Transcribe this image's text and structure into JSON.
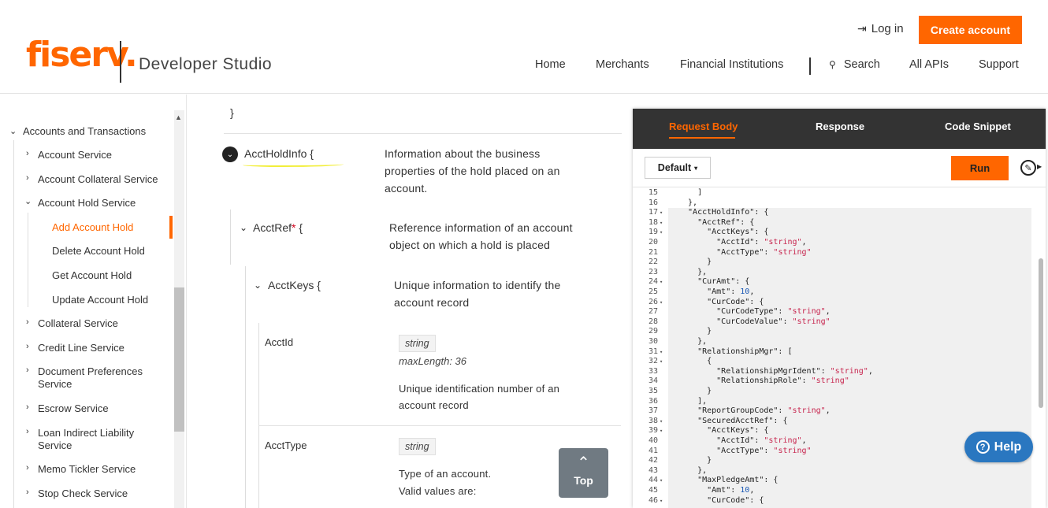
{
  "header": {
    "logo_text": "fiserv.",
    "product_name": "Developer Studio",
    "login_label": "Log in",
    "create_account_label": "Create account",
    "nav": [
      "Home",
      "Merchants",
      "Financial Institutions",
      "Search",
      "All APIs",
      "Support"
    ]
  },
  "sidebar": {
    "items": [
      {
        "label": "Accounts and Transactions",
        "expanded": true
      },
      {
        "label": "Account Service",
        "expanded": false
      },
      {
        "label": "Account Collateral Service",
        "expanded": false
      },
      {
        "label": "Account Hold Service",
        "expanded": true
      },
      {
        "label": "Add Account Hold",
        "active": true
      },
      {
        "label": "Delete Account Hold"
      },
      {
        "label": "Get Account Hold"
      },
      {
        "label": "Update Account Hold"
      },
      {
        "label": "Collateral Service",
        "expanded": false
      },
      {
        "label": "Credit Line Service",
        "expanded": false
      },
      {
        "label": "Document Preferences",
        "label2": "Service",
        "expanded": false
      },
      {
        "label": "Escrow Service",
        "expanded": false
      },
      {
        "label": "Loan Indirect Liability",
        "label2": "Service",
        "expanded": false
      },
      {
        "label": "Memo Tickler Service",
        "expanded": false
      },
      {
        "label": "Stop Check Service",
        "expanded": false
      }
    ]
  },
  "schema": {
    "closing_brace": "}",
    "acct_hold_info": {
      "name": "AcctHoldInfo",
      "brace": "{",
      "desc_lines": [
        "Information about the business",
        "properties of the hold placed on an",
        "account."
      ]
    },
    "acct_ref": {
      "name": "AcctRef",
      "required": "*",
      "brace": "{",
      "desc_lines": [
        "Reference information of an account",
        "object on which a hold is placed"
      ]
    },
    "acct_keys": {
      "name": "AcctKeys",
      "brace": "{",
      "desc_lines": [
        "Unique information to identify the",
        "account record"
      ]
    },
    "acct_id": {
      "name": "AcctId",
      "type": "string",
      "max_length": "maxLength: 36",
      "desc_lines": [
        "Unique identification number of an",
        "account record"
      ]
    },
    "acct_type": {
      "name": "AcctType",
      "type": "string",
      "desc_lines": [
        "Type of an account.",
        "Valid values are:"
      ]
    }
  },
  "panel": {
    "tabs": [
      "Request Body",
      "Response",
      "Code Snippet"
    ],
    "active_tab": 0,
    "default_label": "Default",
    "run_label": "Run",
    "code_lines": [
      {
        "n": "15",
        "fold": false,
        "text": "    ]"
      },
      {
        "n": "16",
        "fold": false,
        "text": "  },"
      },
      {
        "n": "17",
        "fold": true,
        "text": "  \"AcctHoldInfo\": {"
      },
      {
        "n": "18",
        "fold": true,
        "text": "    \"AcctRef\": {"
      },
      {
        "n": "19",
        "fold": true,
        "text": "      \"AcctKeys\": {"
      },
      {
        "n": "20",
        "fold": false,
        "text": "        \"AcctId\": \"string\","
      },
      {
        "n": "21",
        "fold": false,
        "text": "        \"AcctType\": \"string\""
      },
      {
        "n": "22",
        "fold": false,
        "text": "      }"
      },
      {
        "n": "23",
        "fold": false,
        "text": "    },"
      },
      {
        "n": "24",
        "fold": true,
        "text": "    \"CurAmt\": {"
      },
      {
        "n": "25",
        "fold": false,
        "text": "      \"Amt\": 10,"
      },
      {
        "n": "26",
        "fold": true,
        "text": "      \"CurCode\": {"
      },
      {
        "n": "27",
        "fold": false,
        "text": "        \"CurCodeType\": \"string\","
      },
      {
        "n": "28",
        "fold": false,
        "text": "        \"CurCodeValue\": \"string\""
      },
      {
        "n": "29",
        "fold": false,
        "text": "      }"
      },
      {
        "n": "30",
        "fold": false,
        "text": "    },"
      },
      {
        "n": "31",
        "fold": true,
        "text": "    \"RelationshipMgr\": ["
      },
      {
        "n": "32",
        "fold": true,
        "text": "      {"
      },
      {
        "n": "33",
        "fold": false,
        "text": "        \"RelationshipMgrIdent\": \"string\","
      },
      {
        "n": "34",
        "fold": false,
        "text": "        \"RelationshipRole\": \"string\""
      },
      {
        "n": "35",
        "fold": false,
        "text": "      }"
      },
      {
        "n": "36",
        "fold": false,
        "text": "    ],"
      },
      {
        "n": "37",
        "fold": false,
        "text": "    \"ReportGroupCode\": \"string\","
      },
      {
        "n": "38",
        "fold": true,
        "text": "    \"SecuredAcctRef\": {"
      },
      {
        "n": "39",
        "fold": true,
        "text": "      \"AcctKeys\": {"
      },
      {
        "n": "40",
        "fold": false,
        "text": "        \"AcctId\": \"string\","
      },
      {
        "n": "41",
        "fold": false,
        "text": "        \"AcctType\": \"string\""
      },
      {
        "n": "42",
        "fold": false,
        "text": "      }"
      },
      {
        "n": "43",
        "fold": false,
        "text": "    },"
      },
      {
        "n": "44",
        "fold": true,
        "text": "    \"MaxPledgeAmt\": {"
      },
      {
        "n": "45",
        "fold": false,
        "text": "      \"Amt\": 10,"
      },
      {
        "n": "46",
        "fold": true,
        "text": "      \"CurCode\": {"
      }
    ]
  },
  "floating": {
    "top_label": "Top",
    "help_label": "Help"
  },
  "icons": {
    "login": "login-arrow-icon",
    "search": "search-icon",
    "expand": "chevron-down-icon",
    "collapse": "chevron-right-icon",
    "wrench": "wrench-icon",
    "help": "question-circle-icon",
    "top": "arrow-up-icon"
  },
  "colors": {
    "brand": "#ff6600",
    "panel_header": "#333333",
    "help": "#2a77c0",
    "code_string": "#c7254e",
    "code_number": "#1a59b5"
  }
}
